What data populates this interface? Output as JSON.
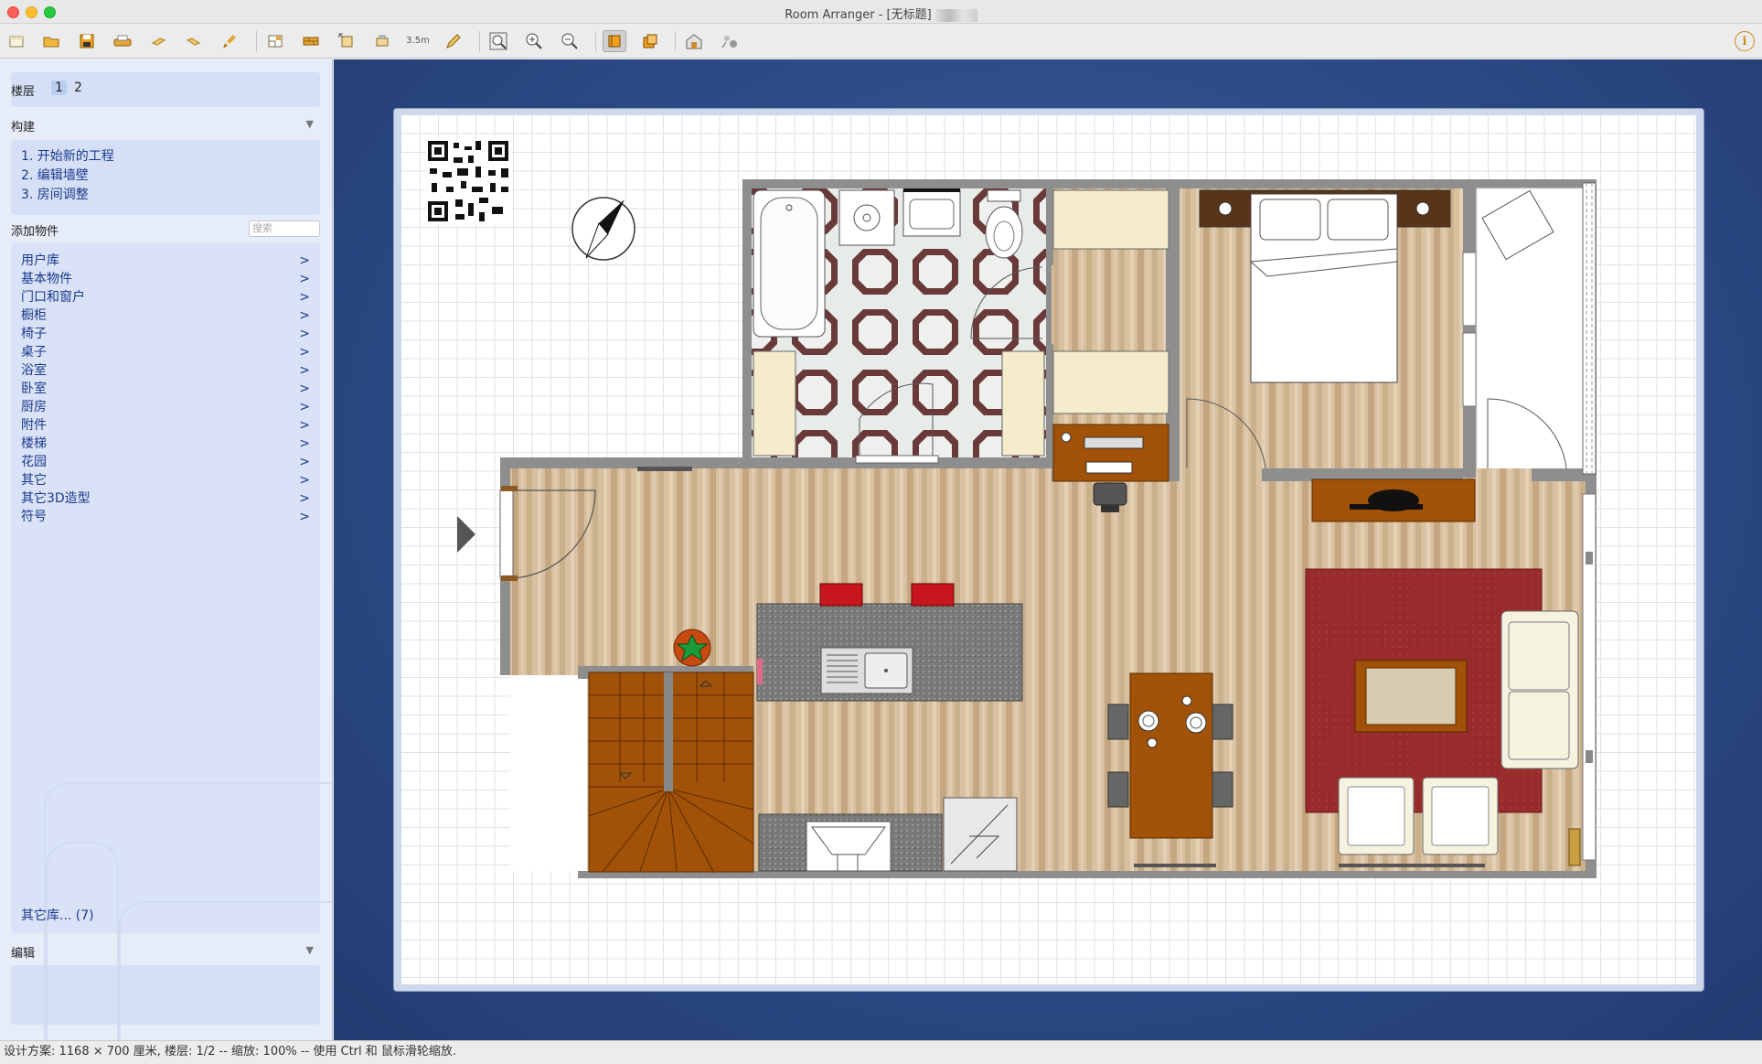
{
  "window": {
    "title": "Room Arranger - [无标题]"
  },
  "toolbar": {
    "buttons": [
      {
        "name": "new-file",
        "icon": "new-file-icon"
      },
      {
        "name": "open-file",
        "icon": "folder-open-icon"
      },
      {
        "name": "save-file",
        "icon": "save-icon"
      },
      {
        "name": "print",
        "icon": "printer-icon"
      },
      {
        "name": "undo",
        "icon": "undo-icon"
      },
      {
        "name": "redo",
        "icon": "redo-icon"
      },
      {
        "name": "clear",
        "icon": "brush-icon"
      },
      {
        "name": "floorplan",
        "icon": "floorplan-icon"
      },
      {
        "name": "walls",
        "icon": "wall-icon"
      },
      {
        "name": "resize",
        "icon": "resize-icon"
      },
      {
        "name": "objects",
        "icon": "objects-icon"
      },
      {
        "name": "measure",
        "icon": "measure-icon",
        "label": "3.5m"
      },
      {
        "name": "pencil",
        "icon": "pencil-icon"
      },
      {
        "name": "zoom-fit",
        "icon": "zoom-fit-icon"
      },
      {
        "name": "zoom-in",
        "icon": "zoom-in-icon"
      },
      {
        "name": "zoom-out",
        "icon": "zoom-out-icon"
      },
      {
        "name": "view-2d",
        "icon": "2d-view-icon",
        "active": true
      },
      {
        "name": "view-floors",
        "icon": "floors-view-icon"
      },
      {
        "name": "view-3d",
        "icon": "3d-house-icon"
      },
      {
        "name": "render-3d",
        "icon": "3d-render-icon"
      }
    ]
  },
  "sidebar": {
    "floors_label": "楼层",
    "floors": [
      "1",
      "2"
    ],
    "selected_floor": "1",
    "build_label": "构建",
    "build_steps": [
      "1. 开始新的工程",
      "2. 编辑墙壁",
      "3. 房间调整"
    ],
    "add_objects_label": "添加物件",
    "search_placeholder": "搜索",
    "categories": [
      "用户库",
      "基本物件",
      "门口和窗户",
      "橱柜",
      "椅子",
      "桌子",
      "浴室",
      "卧室",
      "厨房",
      "附件",
      "楼梯",
      "花园",
      "其它",
      "其它3D造型",
      "符号"
    ],
    "chevron": ">",
    "more_libraries": "其它库... (7)",
    "edit_label": "编辑"
  },
  "statusbar": {
    "text": "设计方案: 1168 × 700 厘米, 楼层: 1/2 -- 缩放: 100% -- 使用 Ctrl 和 鼠标滑轮缩放."
  },
  "colors": {
    "accent_link": "#1a3a8c",
    "sidebar_bg": "#e6ecf8",
    "wood": "#c8a878",
    "furniture_wood": "#a15208",
    "rug": "#9a2a2a",
    "wall": "#8e8e8e"
  }
}
